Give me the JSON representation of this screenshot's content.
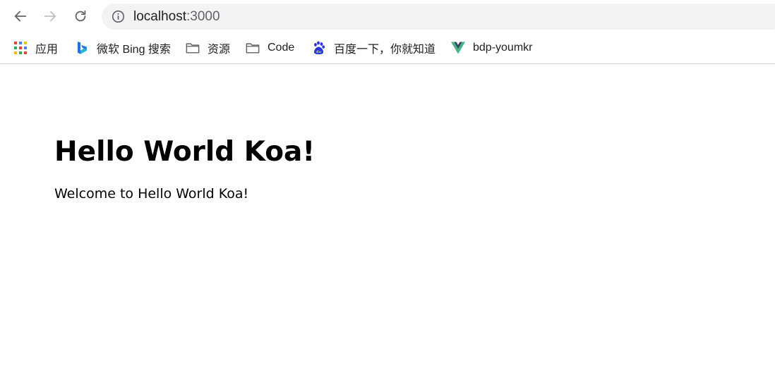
{
  "toolbar": {
    "back_icon": "arrow-left-icon",
    "forward_icon": "arrow-right-icon",
    "reload_icon": "reload-icon",
    "address": {
      "info_icon": "info-circle-icon",
      "host": "localhost",
      "port": ":3000"
    }
  },
  "bookmarks": [
    {
      "label": "应用",
      "icon": "apps-grid-icon"
    },
    {
      "label": "微软 Bing 搜索",
      "icon": "bing-logo-icon"
    },
    {
      "label": "资源",
      "icon": "folder-icon"
    },
    {
      "label": "Code",
      "icon": "folder-icon"
    },
    {
      "label": "百度一下，你就知道",
      "icon": "baidu-paw-icon"
    },
    {
      "label": "bdp-youmkr",
      "icon": "vue-logo-icon"
    }
  ],
  "page": {
    "heading": "Hello World Koa!",
    "paragraph": "Welcome to Hello World Koa!"
  },
  "colors": {
    "omnibox_bg": "#f1f3f4",
    "icon_gray": "#5f6368",
    "divider": "#d3d3d3"
  }
}
